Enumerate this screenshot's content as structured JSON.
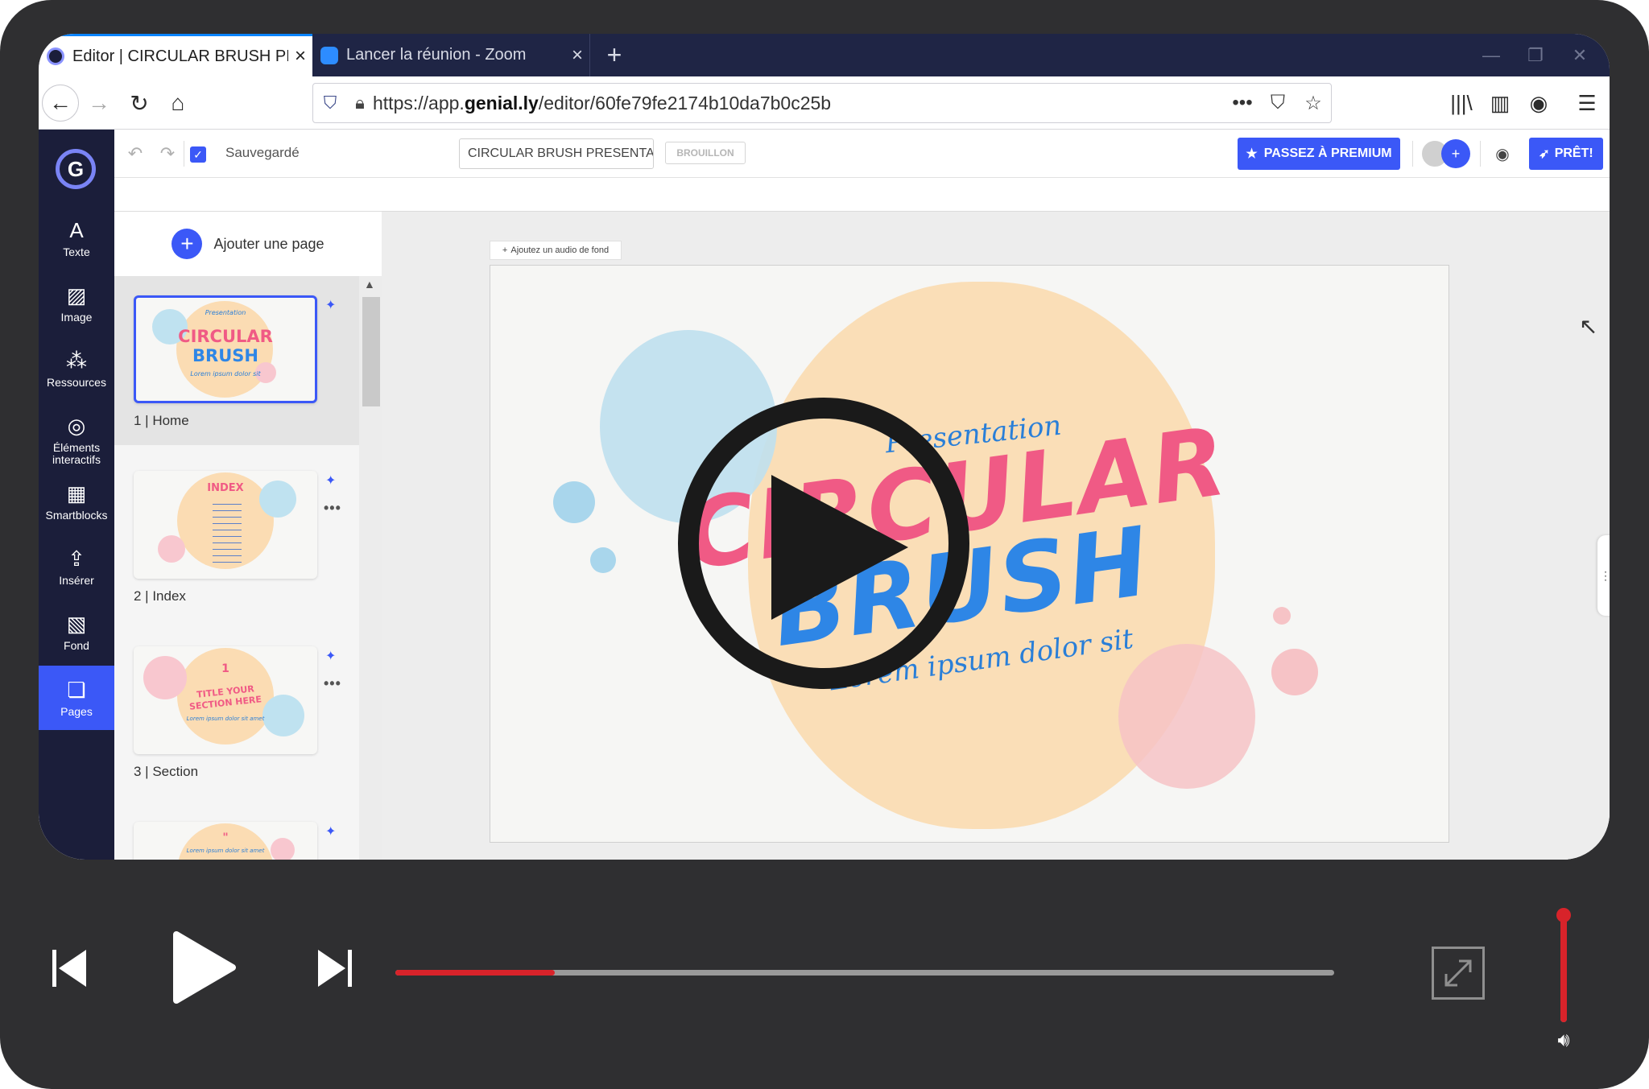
{
  "browser": {
    "tabs": [
      {
        "title": "Editor | CIRCULAR BRUSH PRES",
        "active": true
      },
      {
        "title": "Lancer la réunion - Zoom",
        "active": false
      }
    ],
    "url_prefix": "https://app.",
    "url_domain": "genial.ly",
    "url_path": "/editor/60fe79fe2174b10da7b0c25b"
  },
  "app": {
    "nav": [
      {
        "label": "Texte",
        "icon": "text-icon"
      },
      {
        "label": "Image",
        "icon": "image-icon"
      },
      {
        "label": "Ressources",
        "icon": "resources-icon"
      },
      {
        "label": "Éléments interactifs",
        "icon": "interactive-elements-icon"
      },
      {
        "label": "Smartblocks",
        "icon": "smartblocks-icon"
      },
      {
        "label": "Insérer",
        "icon": "insert-icon"
      },
      {
        "label": "Fond",
        "icon": "background-icon"
      },
      {
        "label": "Pages",
        "icon": "pages-icon",
        "active": true
      }
    ],
    "toolbar": {
      "saved_label": "Sauvegardé",
      "title_value": "CIRCULAR BRUSH PRESENTAT",
      "draft_label": "BROUILLON",
      "premium_label": "PASSEZ À PREMIUM",
      "ready_label": "PRÊT!"
    },
    "pages_panel": {
      "add_page_label": "Ajouter une page",
      "pages": [
        {
          "label": "1 |  Home",
          "thumb_title": "CIRCULAR",
          "thumb_title2": "BRUSH",
          "thumb_script": "Presentation",
          "thumb_sub": "Lorem ipsum dolor sit"
        },
        {
          "label": "2 |  Index",
          "thumb_title": "INDEX"
        },
        {
          "label": "3 |  Section",
          "thumb_num": "1",
          "thumb_title": "TITLE YOUR",
          "thumb_title2": "SECTION HERE",
          "thumb_sub": "Lorem ipsum dolor sit amet"
        },
        {
          "label": "",
          "thumb_title": "\"",
          "thumb_sub": "Lorem ipsum dolor sit amet"
        }
      ]
    },
    "canvas": {
      "audio_label": "Ajoutez un audio de fond",
      "slide": {
        "script_title": "Presentation",
        "title_line1": "CIRCULAR",
        "title_line2": "BRUSH",
        "tagline": "Lorem ipsum dolor sit"
      }
    }
  },
  "player": {
    "progress": 0.17,
    "volume": 0.95
  },
  "colors": {
    "accent": "#3b58f7",
    "tab_bar": "#1f2545",
    "pink": "#f05a85",
    "blue": "#2e86e6",
    "player_red": "#d8232a"
  }
}
